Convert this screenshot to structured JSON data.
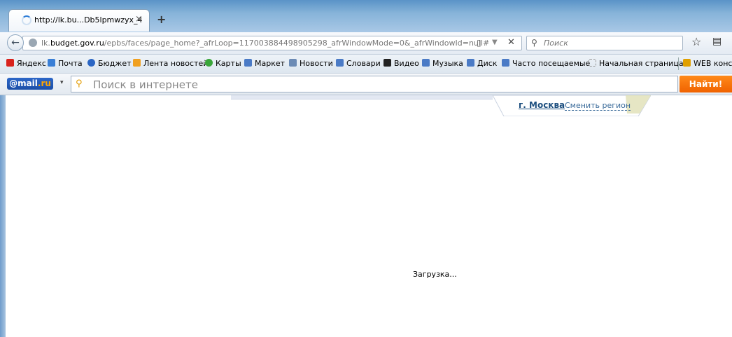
{
  "browser": {
    "tab": {
      "title": "http://lk.bu...Db5lpmwzyx_4",
      "close": "×"
    },
    "new_tab": "+",
    "nav": {
      "back": "←",
      "url_domain": "lk.budget.gov.ru",
      "url_path": "/epbs/faces/page_home?_afrLoop=117003884498905298_afrWindowMode=0&_afrWindowId=null#",
      "url_prefix": "lk.",
      "reader": "▯",
      "dropdown": "▼",
      "stop": "✕",
      "search_placeholder": "Поиск",
      "search_icon": "search-icon",
      "bookmark_star": "☆",
      "library": "▤"
    }
  },
  "bookmarks": [
    {
      "label": "Яндекс",
      "icon": "yandex-icon",
      "color": "#d9231d"
    },
    {
      "label": "Почта",
      "icon": "mail-icon",
      "color": "#3a7fd6"
    },
    {
      "label": "Бюджет",
      "icon": "budget-icon",
      "color": "#2b66c4"
    },
    {
      "label": "Лента новостей",
      "icon": "rss-icon",
      "color": "#f0a020"
    },
    {
      "label": "Карты",
      "icon": "maps-icon",
      "color": "#3aa63a"
    },
    {
      "label": "Маркет",
      "icon": "market-icon",
      "color": "#4b7bc6"
    },
    {
      "label": "Новости",
      "icon": "news-icon",
      "color": "#6c8bb5"
    },
    {
      "label": "Словари",
      "icon": "dictionary-icon",
      "color": "#4b7bc6"
    },
    {
      "label": "Видео",
      "icon": "video-icon",
      "color": "#222222"
    },
    {
      "label": "Музыка",
      "icon": "music-icon",
      "color": "#4b7bc6"
    },
    {
      "label": "Диск",
      "icon": "disk-icon",
      "color": "#4b7bc6"
    },
    {
      "label": "Часто посещаемые",
      "icon": "frequent-icon",
      "color": "#4b7bc6"
    },
    {
      "label": "Начальная страница",
      "icon": "home-page-icon",
      "color": "#bbbbbb"
    },
    {
      "label": "WEB консо",
      "icon": "web-console-icon",
      "color": "#e0a000"
    }
  ],
  "mail_toolbar": {
    "logo_at": "@mail",
    "logo_ru": ".ru",
    "dropdown": "▾",
    "search_placeholder": "Поиск в интернете",
    "find_button": "Найти!"
  },
  "page": {
    "region_city": "г. Москва",
    "region_change": "Сменить регион",
    "loading": "Загрузка..."
  }
}
